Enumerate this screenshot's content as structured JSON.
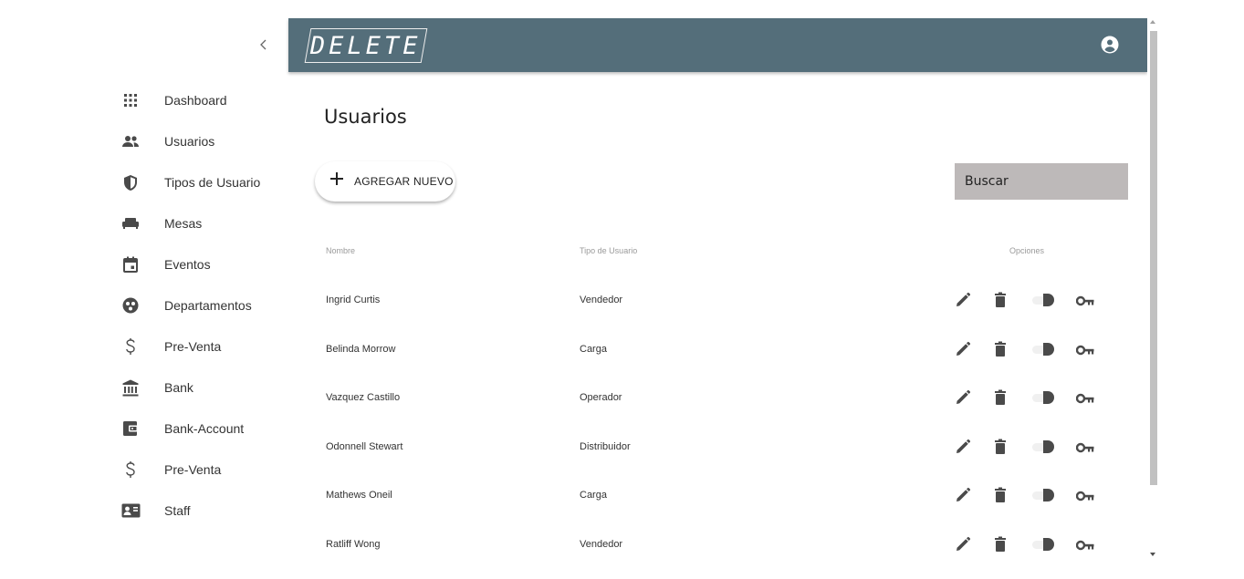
{
  "app": {
    "logo_text": "DELETE"
  },
  "sidebar": {
    "items": [
      {
        "label": "Dashboard",
        "icon": "apps-grid-icon"
      },
      {
        "label": "Usuarios",
        "icon": "people-icon"
      },
      {
        "label": "Tipos de Usuario",
        "icon": "shield-icon"
      },
      {
        "label": "Mesas",
        "icon": "couch-icon"
      },
      {
        "label": "Eventos",
        "icon": "calendar-icon"
      },
      {
        "label": "Departamentos",
        "icon": "group-circle-icon"
      },
      {
        "label": "Pre-Venta",
        "icon": "dollar-icon"
      },
      {
        "label": "Bank",
        "icon": "bank-icon"
      },
      {
        "label": "Bank-Account",
        "icon": "wallet-icon"
      },
      {
        "label": "Pre-Venta",
        "icon": "dollar-icon"
      },
      {
        "label": "Staff",
        "icon": "contact-card-icon"
      }
    ]
  },
  "main": {
    "title": "Usuarios",
    "add_button_label": "AGREGAR NUEVO",
    "search_placeholder": "Buscar",
    "table": {
      "columns": [
        "Nombre",
        "Tipo de Usuario",
        "Opciones"
      ],
      "rows": [
        {
          "name": "Ingrid Curtis",
          "type": "Vendedor"
        },
        {
          "name": "Belinda Morrow",
          "type": "Carga"
        },
        {
          "name": "Vazquez Castillo",
          "type": "Operador"
        },
        {
          "name": "Odonnell Stewart",
          "type": "Distribuidor"
        },
        {
          "name": "Mathews Oneil",
          "type": "Carga"
        },
        {
          "name": "Ratliff Wong",
          "type": "Vendedor"
        }
      ]
    }
  },
  "colors": {
    "header": "#546e7a",
    "search_bg": "#bdb9b9",
    "icon": "#4a4a4a"
  }
}
